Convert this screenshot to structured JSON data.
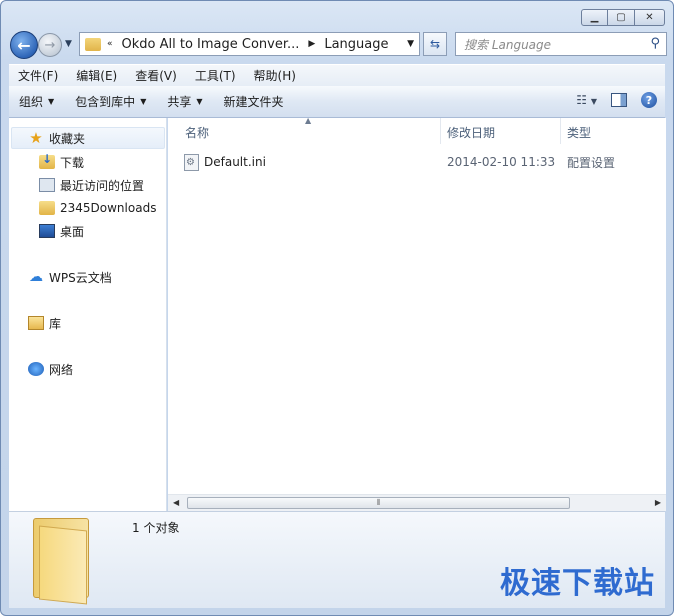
{
  "window": {
    "caption_buttons": [
      "minimize",
      "maximize",
      "close"
    ]
  },
  "address": {
    "overflow": "«",
    "segments": [
      "Okdo All to Image Conver...",
      "Language"
    ]
  },
  "search": {
    "placeholder": "搜索 Language"
  },
  "menu": [
    "文件(F)",
    "编辑(E)",
    "查看(V)",
    "工具(T)",
    "帮助(H)"
  ],
  "toolbar": {
    "organize": "组织",
    "include_in_library": "包含到库中",
    "share": "共享",
    "new_folder": "新建文件夹"
  },
  "sidebar": {
    "favorites": "收藏夹",
    "items": [
      "下载",
      "最近访问的位置",
      "2345Downloads",
      "桌面"
    ],
    "wps": "WPS云文档",
    "library": "库",
    "network": "网络"
  },
  "columns": {
    "name": "名称",
    "date": "修改日期",
    "type": "类型"
  },
  "files": [
    {
      "name": "Default.ini",
      "date": "2014-02-10 11:33",
      "type": "配置设置"
    }
  ],
  "details": {
    "count": "1 个对象"
  },
  "watermark": "极速下载站",
  "colors": {
    "accent": "#2f6bd0",
    "frame": "#c9d9ee"
  }
}
